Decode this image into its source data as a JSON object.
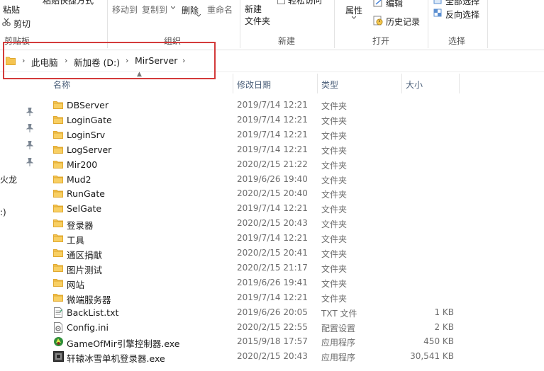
{
  "ribbon": {
    "clipboard": {
      "paste_label": "粘贴",
      "cut_label": "剪切",
      "paste_shortcut_label": "粘贴快捷方式",
      "group_label": "剪贴板"
    },
    "organize": {
      "move_to_label": "移动到",
      "copy_to_label": "复制到",
      "delete_label": "删除",
      "rename_label": "重命名",
      "group_label": "组织"
    },
    "new": {
      "new_folder_label": "新建\n文件夹",
      "easy_access_label": "轻松访问",
      "group_label": "新建"
    },
    "open": {
      "properties_label": "属性",
      "edit_label": "编辑",
      "history_label": "历史记录",
      "group_label": "打开"
    },
    "select": {
      "select_all_label": "全部选择",
      "invert_label": "反向选择",
      "group_label": "选择"
    }
  },
  "address_bar": {
    "crumbs": [
      "此电脑",
      "新加卷 (D:)",
      "MirServer"
    ]
  },
  "nav_pane": {
    "items": [
      "火龙",
      ":)"
    ]
  },
  "columns": {
    "name": "名称",
    "date": "修改日期",
    "type": "类型",
    "size": "大小"
  },
  "files": [
    {
      "name": "DBServer",
      "date": "2019/7/14 12:21",
      "type": "文件夹",
      "size": "",
      "icon": "folder-icon"
    },
    {
      "name": "LoginGate",
      "date": "2019/7/14 12:21",
      "type": "文件夹",
      "size": "",
      "icon": "folder-icon"
    },
    {
      "name": "LoginSrv",
      "date": "2019/7/14 12:21",
      "type": "文件夹",
      "size": "",
      "icon": "folder-icon"
    },
    {
      "name": "LogServer",
      "date": "2019/7/14 12:21",
      "type": "文件夹",
      "size": "",
      "icon": "folder-icon"
    },
    {
      "name": "Mir200",
      "date": "2020/2/15 21:22",
      "type": "文件夹",
      "size": "",
      "icon": "folder-icon"
    },
    {
      "name": "Mud2",
      "date": "2019/6/26 19:40",
      "type": "文件夹",
      "size": "",
      "icon": "folder-icon"
    },
    {
      "name": "RunGate",
      "date": "2020/2/15 20:40",
      "type": "文件夹",
      "size": "",
      "icon": "folder-icon"
    },
    {
      "name": "SelGate",
      "date": "2019/7/14 12:21",
      "type": "文件夹",
      "size": "",
      "icon": "folder-icon"
    },
    {
      "name": "登录器",
      "date": "2020/2/15 20:43",
      "type": "文件夹",
      "size": "",
      "icon": "folder-icon"
    },
    {
      "name": "工具",
      "date": "2019/7/14 12:21",
      "type": "文件夹",
      "size": "",
      "icon": "folder-icon"
    },
    {
      "name": "通区捐献",
      "date": "2020/2/15 20:41",
      "type": "文件夹",
      "size": "",
      "icon": "folder-icon"
    },
    {
      "name": "图片测试",
      "date": "2020/2/15 21:17",
      "type": "文件夹",
      "size": "",
      "icon": "folder-icon"
    },
    {
      "name": "网站",
      "date": "2019/6/26 19:41",
      "type": "文件夹",
      "size": "",
      "icon": "folder-icon"
    },
    {
      "name": "微端服务器",
      "date": "2019/7/14 12:21",
      "type": "文件夹",
      "size": "",
      "icon": "folder-icon"
    },
    {
      "name": "BackList.txt",
      "date": "2019/6/26 20:05",
      "type": "TXT 文件",
      "size": "1 KB",
      "icon": "text-file-icon"
    },
    {
      "name": "Config.ini",
      "date": "2020/2/15 22:55",
      "type": "配置设置",
      "size": "2 KB",
      "icon": "ini-file-icon"
    },
    {
      "name": "GameOfMir引擎控制器.exe",
      "date": "2015/9/18 17:57",
      "type": "应用程序",
      "size": "450 KB",
      "icon": "app-green-icon"
    },
    {
      "name": "轩辕冰雪单机登录器.exe",
      "date": "2020/2/15 20:43",
      "type": "应用程序",
      "size": "30,541 KB",
      "icon": "app-dark-icon"
    }
  ],
  "colors": {
    "folder": "#f5c451",
    "folder_dark": "#e0a82e",
    "highlight_border": "#d33b3b",
    "header_text": "#4c607a"
  }
}
